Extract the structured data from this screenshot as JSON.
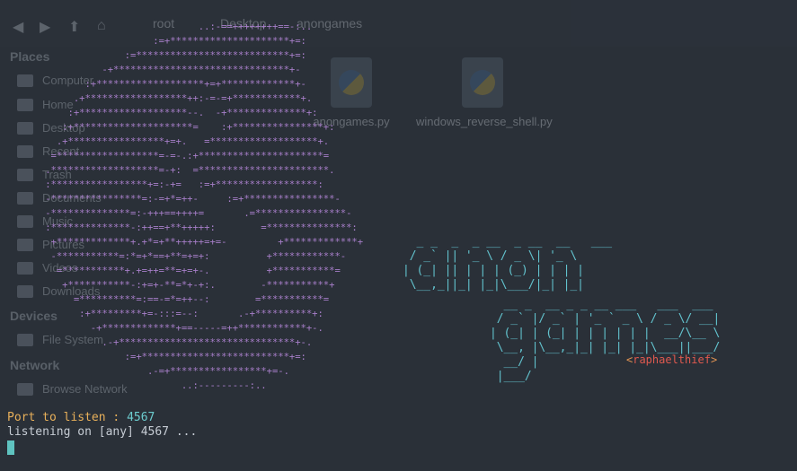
{
  "file_manager": {
    "nav_icons": [
      "back-icon",
      "forward-icon",
      "up-icon",
      "home-icon"
    ],
    "breadcrumb": [
      "root",
      "Desktop",
      "anongames"
    ],
    "places_heading": "Places",
    "places": [
      "Computer",
      "Home",
      "Desktop",
      "Recent",
      "Trash",
      "Documents",
      "Music",
      "Pictures",
      "Videos",
      "Downloads"
    ],
    "devices_heading": "Devices",
    "devices": [
      "File System"
    ],
    "network_heading": "Network",
    "network": [
      "Browse Network"
    ],
    "files": [
      {
        "name": "anongames.py",
        "icon": "python-file-icon"
      },
      {
        "name": "windows_reverse_shell.py",
        "icon": "python-file-icon"
      }
    ]
  },
  "terminal": {
    "skull_ascii": "                                  ..:-==++++++++==-:..\n                          :=+*********************+=:\n                     :=***************************+=:\n                 -+*******************************+-\n              :+*******************+=+*************+-\n            .+******************++:-=-=+************+.\n           :+*******************--.  -+**************+:\n          :+*********************=    :+****************+:\n         .+*****************+=+.   =*******************+.\n        =******************=-=-.:+**********************=\n       .*******************=-+:  =***********************.\n       :*****************+=:-+=   :=+******************:\n       -****************=:-=+*=++-     :=+****************-\n       -**************=:-+++==++++=       .=****************-\n       :**************-:++==+**+++++:        =***************:\n        +*************+.+*=+**+++++=+=-         +*************+\n        -***********=:*=+*==+**=+=+:          +************-\n         =***********+.+=++=**=+=+-.          +***********=\n          +***********-:+=+-**=*+-+:.        -***********+\n            =**********=:==-=*=++--:        =***********=\n             :+*********+=-:::=--:       .-+**********+:\n               -+*************+==-----=++************+-.\n                 .-+*******************************+-.\n                     :=+**************************+=:\n                         .-=+*****************+=-.\n                               ..:---------:..",
    "banner_word1": "  _ _  _  _ __  _ __  __   ___\n / _` || '_ \\ / _ \\| '_ \\\n| (_| || | | | (_) | | | |\n \\__,_||_| |_|\\___/|_| |_|",
    "banner_word2": "  __ _  __ _ _ __ ___   ___  ___\n / _` |/ _` | '_ ` _ \\ / _ \\/ __|\n| (_| | (_| | | | | | |  __/\\__ \\\n \\__, |\\__,_|_| |_| |_|\\___||___/\n  __/ |\n |___/",
    "credit_open": "<",
    "credit_name": "raphaelthief",
    "credit_close": ">",
    "line1_prompt": "Port to listen : ",
    "line1_value": "4567",
    "line2_text": "listening on [any] 4567 ..."
  },
  "colors": {
    "background": "#2a3038",
    "skull": "#a77ec9",
    "banner": "#62c2cd",
    "prompt": "#e8b05a",
    "credit_name": "#e0594f",
    "cursor": "#5fc3c0"
  }
}
